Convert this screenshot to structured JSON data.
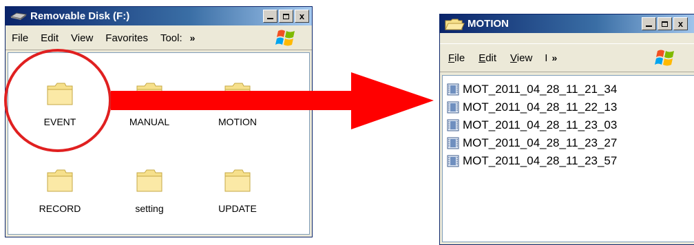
{
  "window1": {
    "title": "Removable Disk (F:)",
    "buttons": {
      "minimize": "_",
      "maximize": "□",
      "close": "x"
    },
    "menu": [
      "File",
      "Edit",
      "View",
      "Favorites",
      "Tool:"
    ],
    "menu_more": "»",
    "folders": [
      "EVENT",
      "MANUAL",
      "MOTION",
      "RECORD",
      "setting",
      "UPDATE"
    ],
    "highlighted_folder": "EVENT"
  },
  "window2": {
    "title": "MOTION",
    "buttons": {
      "minimize": "_",
      "maximize": "□",
      "close": "x"
    },
    "menu": [
      "File",
      "Edit",
      "View",
      "I"
    ],
    "menu_more": "»",
    "files": [
      "MOT_2011_04_28_11_21_34",
      "MOT_2011_04_28_11_22_13",
      "MOT_2011_04_28_11_23_03",
      "MOT_2011_04_28_11_23_27",
      "MOT_2011_04_28_11_23_57"
    ]
  },
  "annotation": {
    "circle_color": "#e02020",
    "arrow_color": "#ff0000"
  },
  "icons": {
    "folder": "folder-icon",
    "file": "video-file-icon",
    "drive": "removable-disk-icon",
    "windows": "windows-logo-icon"
  }
}
